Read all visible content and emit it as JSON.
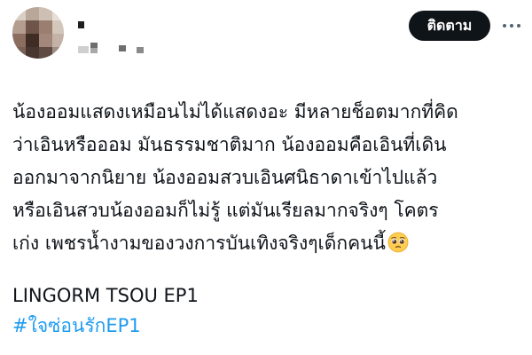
{
  "header": {
    "follow_label": "ติดตาม",
    "more_icon": "more-horizontal-icon",
    "avatar_icon": "pixelated-avatar"
  },
  "tweet": {
    "lines": [
      "น้องออมแสดงเหมือนไม่ได้แสดงอะ มีหลายช็อตมากที่คิด",
      "ว่าเอินหรือออม มันธรรมชาติมาก น้องออมคือเอินที่เดิน",
      "ออกมาจากนิยาย น้องออมสวบเอินศนิธาดาเข้าไปแล้ว",
      "หรือเอินสวบน้องออมก็ไม่รู้ แต่มันเรียลมากจริงๆ โคตร",
      "เก่ง เพชรน้ำงามของวงการบันเทิงจริงๆเด็กคนนี้"
    ],
    "emoji_icon": "pleading-face-emoji",
    "tagline": "LINGORM TSOU EP1",
    "hashtag": "#ใจซ่อนรักEP1"
  },
  "colors": {
    "text": "#0f1419",
    "follow_bg": "#0f1419",
    "follow_text": "#ffffff",
    "hashtag": "#1d9bf0",
    "secondary": "#536471"
  }
}
